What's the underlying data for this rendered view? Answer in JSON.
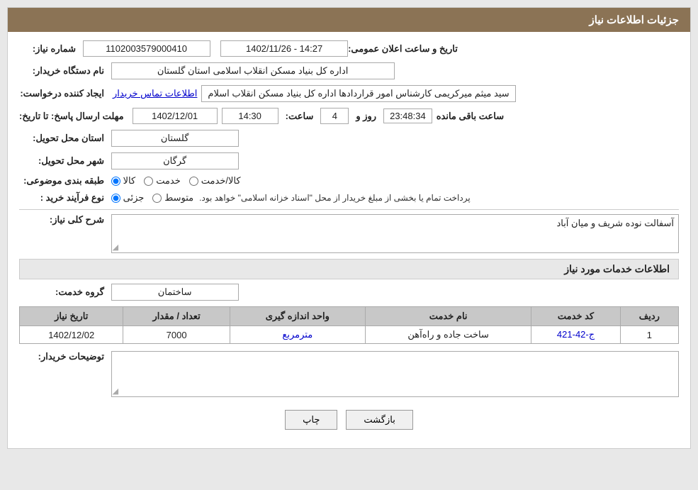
{
  "header": {
    "title": "جزئیات اطلاعات نیاز"
  },
  "fields": {
    "shomara_niaz_label": "شماره نیاز:",
    "shomara_niaz_value": "1102003579000410",
    "nam_dastgah_label": "نام دستگاه خریدار:",
    "nam_dastgah_value": "اداره کل بنیاد مسکن انقلاب اسلامی استان گلستان",
    "ijad_konande_label": "ایجاد کننده درخواست:",
    "ijad_konande_value": "سید میثم میرکریمی کارشناس امور قراردادها اداره کل بنیاد مسکن انقلاب اسلام",
    "ijad_konande_link": "اطلاعات تماس خریدار",
    "mohlet_ersal_label": "مهلت ارسال پاسخ: تا تاریخ:",
    "mohlet_date": "1402/12/01",
    "mohlet_saat_label": "ساعت:",
    "mohlet_saat": "14:30",
    "mohlet_roz_label": "روز و",
    "mohlet_roz": "4",
    "countdown": "23:48:34",
    "remaining_label": "ساعت باقی مانده",
    "ostan_label": "استان محل تحویل:",
    "ostan_value": "گلستان",
    "shahr_label": "شهر محل تحویل:",
    "shahr_value": "گرگان",
    "tabaqebandi_label": "طبقه بندی موضوعی:",
    "tabaqebandi_options": [
      "کالا",
      "خدمت",
      "کالا/خدمت"
    ],
    "tabaqebandi_selected": "کالا",
    "noefrayand_label": "نوع فرآیند خرید :",
    "noefrayand_options": [
      "جزئی",
      "متوسط"
    ],
    "noefrayand_selected": "جزئی",
    "noefrayand_note": "پرداخت تمام یا بخشی از مبلغ خریدار از محل \"اسناد خزانه اسلامی\" خواهد بود.",
    "sharh_label": "شرح کلی نیاز:",
    "sharh_value": "آسفالت نوده شریف و میان آباد",
    "service_section": "اطلاعات خدمات مورد نیاز",
    "grohe_khedmat_label": "گروه خدمت:",
    "grohe_khedmat_value": "ساختمان",
    "table": {
      "headers": [
        "ردیف",
        "کد خدمت",
        "نام خدمت",
        "واحد اندازه گیری",
        "تعداد / مقدار",
        "تاریخ نیاز"
      ],
      "rows": [
        {
          "radif": "1",
          "code": "ج-42-421",
          "name": "ساخت جاده و راه‌آهن",
          "unit": "مترمربع",
          "quantity": "7000",
          "date": "1402/12/02"
        }
      ]
    },
    "tozihat_label": "توضیحات خریدار:",
    "tozihat_value": "",
    "buttons": {
      "print": "چاپ",
      "back": "بازگشت"
    }
  },
  "date_announce_label": "تاریخ و ساعت اعلان عمومی:",
  "date_announce_value": "1402/11/26 - 14:27"
}
